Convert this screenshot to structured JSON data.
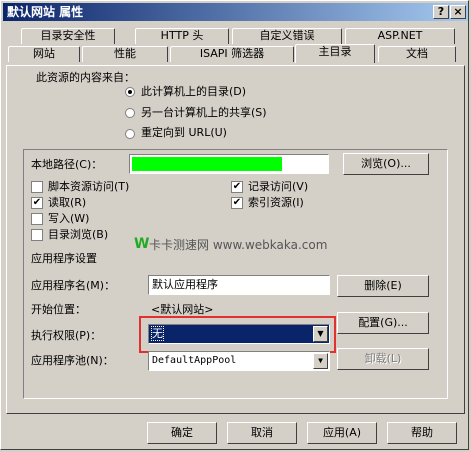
{
  "window": {
    "title": "默认网站 属性",
    "help_btn": "?",
    "close_btn": "×"
  },
  "tabs_top": [
    "目录安全性",
    "HTTP 头",
    "自定义错误",
    "ASP.NET"
  ],
  "tabs_bottom": [
    "网站",
    "性能",
    "ISAPI 筛选器",
    "主目录",
    "文档"
  ],
  "source": {
    "label": "此资源的内容来自：",
    "options": [
      "此计算机上的目录(D)",
      "另一台计算机上的共享(S)",
      "重定向到 URL(U)"
    ]
  },
  "local_path": {
    "label": "本地路径(C)：",
    "browse": "浏览(O)...",
    "fill_color": "#00ff00"
  },
  "checks_left": [
    {
      "label": "脚本资源访问(T)",
      "checked": false
    },
    {
      "label": "读取(R)",
      "checked": true
    },
    {
      "label": "写入(W)",
      "checked": false
    },
    {
      "label": "目录浏览(B)",
      "checked": false
    }
  ],
  "checks_right": [
    {
      "label": "记录访问(V)",
      "checked": true
    },
    {
      "label": "索引资源(I)",
      "checked": true
    }
  ],
  "watermark": {
    "w": "W",
    "text": "卡卡测速网 www.webkaka.com",
    "brand_color": "#22aa22"
  },
  "app": {
    "section": "应用程序设置",
    "name_label": "应用程序名(M)：",
    "name_value": "默认应用程序",
    "delete": "删除(E)",
    "start_label": "开始位置：",
    "start_value": "<默认网站>",
    "config": "配置(G)...",
    "exec_label": "执行权限(P)：",
    "exec_value": "无",
    "unload": "卸载(L)",
    "pool_label": "应用程序池(N)：",
    "pool_value": "DefaultAppPool",
    "highlight_color": "#e03030"
  },
  "footer": {
    "ok": "确定",
    "cancel": "取消",
    "apply": "应用(A)",
    "help": "帮助"
  }
}
